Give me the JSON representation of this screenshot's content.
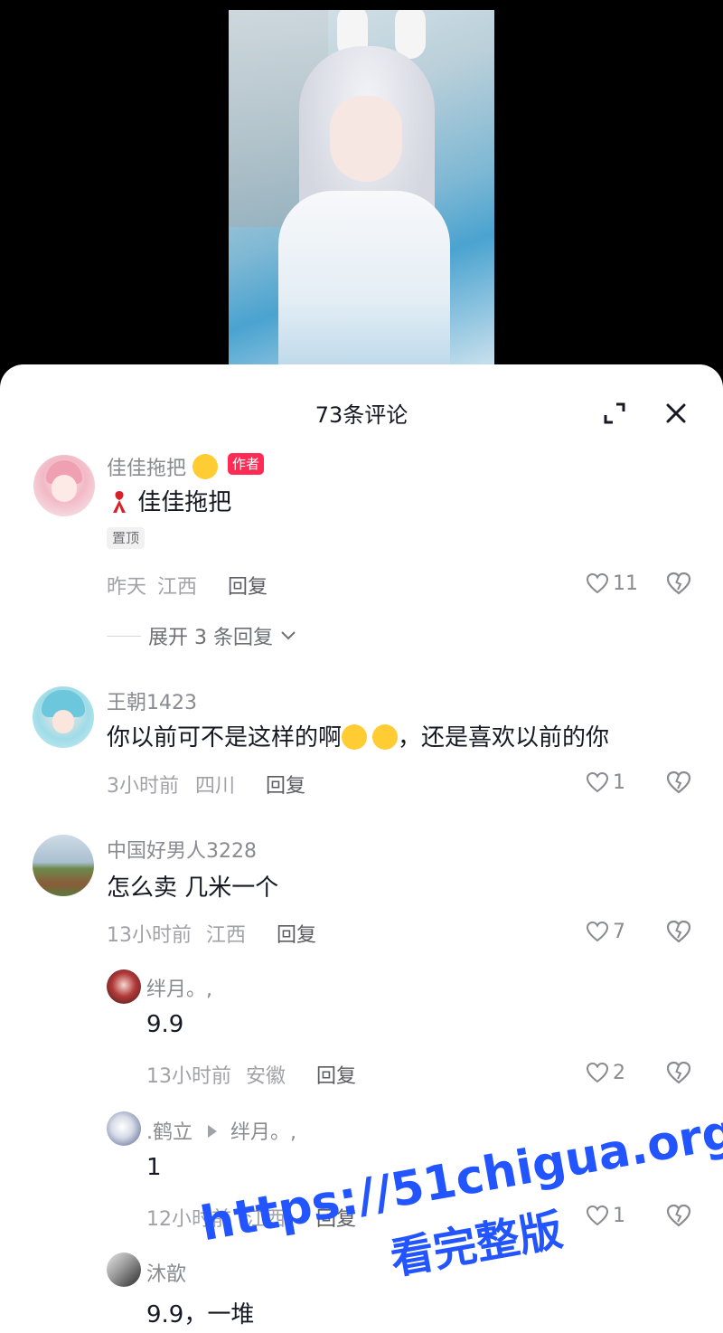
{
  "header": {
    "title": "73条评论"
  },
  "comments": [
    {
      "user": "佳佳拖把",
      "badge": "作者",
      "text": "佳佳拖把",
      "pin": "置顶",
      "time": "昨天",
      "location": "江西",
      "reply": "回复",
      "likes": "11",
      "expand": "展开 3 条回复"
    },
    {
      "user": "王朝1423",
      "text_a": "你以前可不是这样的啊",
      "text_b": "，还是喜欢以前的你",
      "time": "3小时前",
      "location": "四川",
      "reply": "回复",
      "likes": "1"
    },
    {
      "user": "中国好男人3228",
      "text": "怎么卖 几米一个",
      "time": "13小时前",
      "location": "江西",
      "reply": "回复",
      "likes": "7"
    }
  ],
  "replies": [
    {
      "user": "绊月。,",
      "text": "9.9",
      "time": "13小时前",
      "location": "安徽",
      "reply": "回复",
      "likes": "2"
    },
    {
      "user": ".鹤立",
      "reply_to": "绊月。,",
      "text": "1",
      "time": "12小时前",
      "location": "江西",
      "reply": "回复",
      "likes": "1"
    },
    {
      "user": "沐歆",
      "text": "9.9，一堆"
    }
  ],
  "watermark": {
    "url": "https://51chigua.org",
    "sub": "看完整版"
  }
}
